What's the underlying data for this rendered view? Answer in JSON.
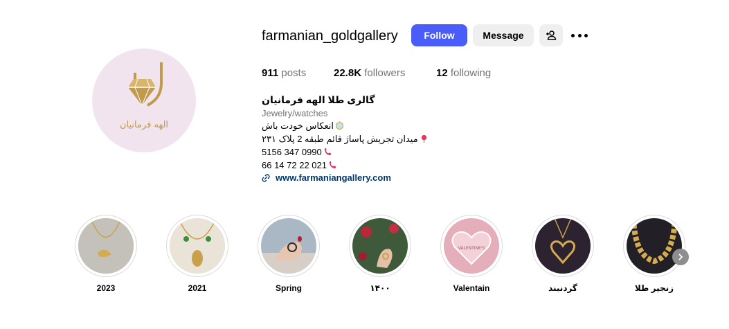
{
  "profile": {
    "username": "farmanian_goldgallery",
    "avatar_logo_text": "الهه فرمانیان",
    "follow_label": "Follow",
    "message_label": "Message",
    "add_user_icon": "person-plus-icon",
    "more_icon": "more-horizontal-icon"
  },
  "stats": {
    "posts_count": "911",
    "posts_label": "posts",
    "followers_count": "22.8K",
    "followers_label": "followers",
    "following_count": "12",
    "following_label": "following"
  },
  "bio": {
    "name": "گالری طلا الهه فرمانیان",
    "category": "Jewelry/watches",
    "line1": "انعکاس خودت باش",
    "line2": "میدان تجریش پاساژ قائم طبقه 2 پلاک ۲۳۱",
    "line3": "5156 347 0990",
    "line4": "66 14 72 22 021",
    "link": "www.farmaniangallery.com"
  },
  "highlights": [
    {
      "label": "2023"
    },
    {
      "label": "2021"
    },
    {
      "label": "Spring"
    },
    {
      "label": "۱۴۰۰"
    },
    {
      "label": "Valentain"
    },
    {
      "label": "گردنبند"
    },
    {
      "label": "زنجیر طلا"
    }
  ],
  "highlight_valentine_text": "VALENTINE'S",
  "colors": {
    "accent": "#4a5df9",
    "gold": "#c19a4b",
    "link": "#00376b",
    "muted": "#737373"
  }
}
